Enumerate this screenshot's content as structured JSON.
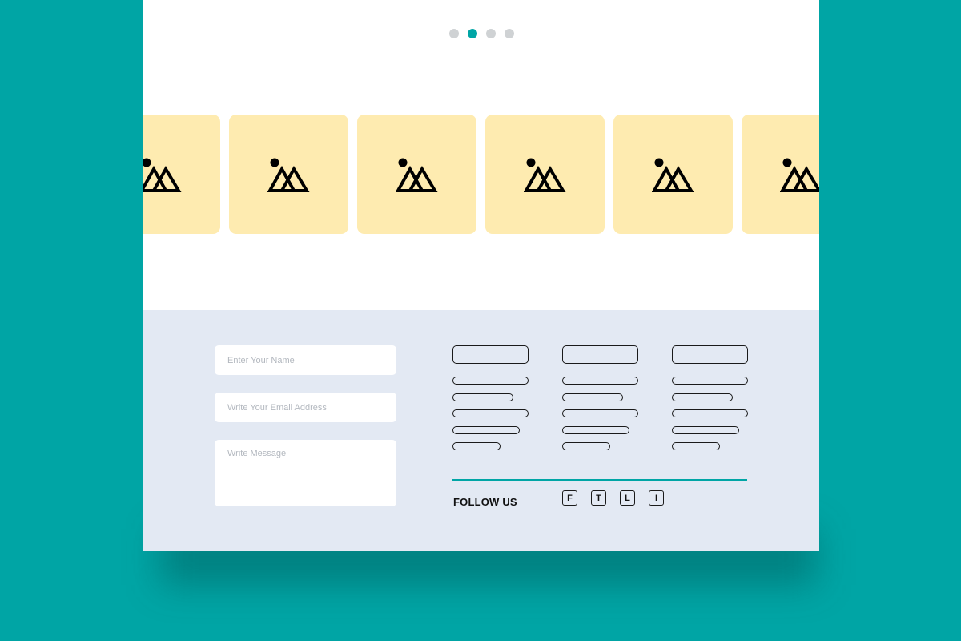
{
  "carousel": {
    "active_index": 1,
    "total": 4,
    "accent_color": "#00a5a5"
  },
  "gallery": {
    "icon": "image-placeholder-icon",
    "tile_color": "#feebb0",
    "tile_count": 6
  },
  "contact_form": {
    "name_placeholder": "Enter Your Name",
    "email_placeholder": "Write Your Email Address",
    "message_placeholder": "Write Message"
  },
  "footer": {
    "background": "#e3e9f3",
    "follow_label": "FOLLOW US",
    "social_links": [
      "F",
      "T",
      "L",
      "I"
    ]
  },
  "colors": {
    "backdrop": "#00a5a5",
    "page": "#ffffff"
  }
}
